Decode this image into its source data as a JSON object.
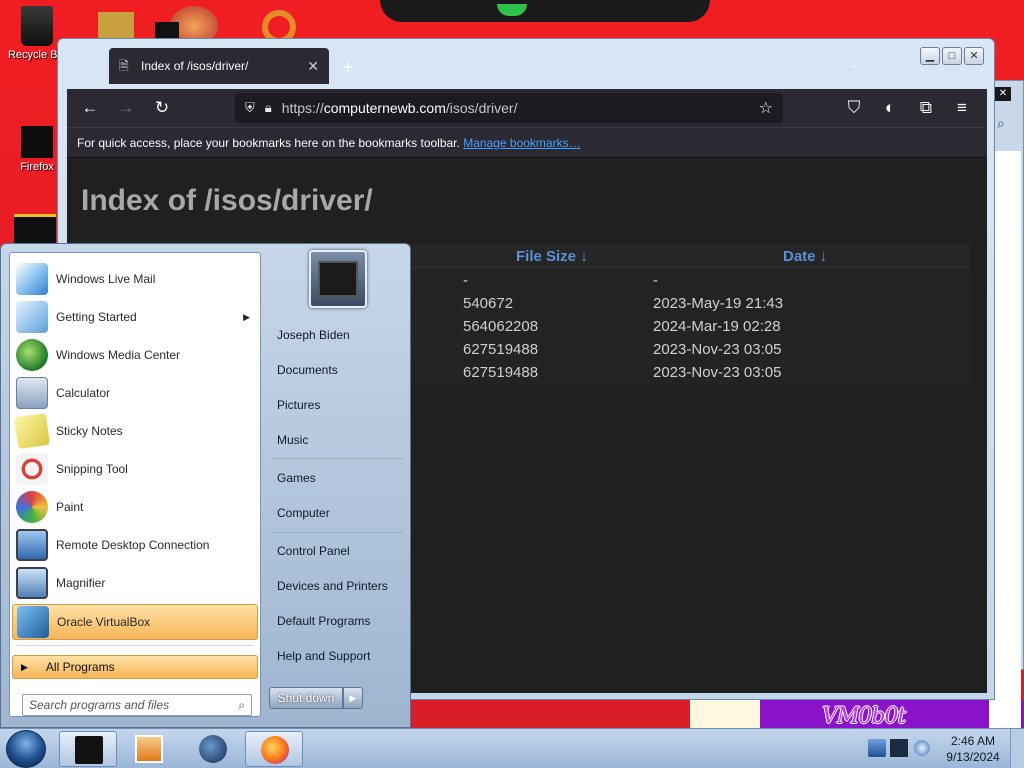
{
  "desktop": {
    "icons": [
      {
        "label": "Recycle Bin",
        "icon": "recycle-bin-icon"
      },
      {
        "label": "Firefox",
        "icon": "firefox-icon"
      }
    ],
    "wallpaper_text": "VM0b0t"
  },
  "browser": {
    "tab": {
      "title": "Index of /isos/driver/",
      "icon": "file-icon",
      "close_glyph": "✕"
    },
    "new_tab_glyph": "+",
    "tab_list_glyph": "⌄",
    "window_controls": {
      "minimize": "▁",
      "maximize": "□",
      "close": "✕"
    },
    "toolbar": {
      "back": "←",
      "forward": "→",
      "reload": "↻",
      "url_prefix": "https://",
      "url_host": "computernewb.com",
      "url_path": "/isos/driver/",
      "bookmark_star": "☆",
      "pocket": "⛉",
      "account": "◐",
      "extensions": "⧉",
      "menu": "≡"
    },
    "bookmarks_bar": {
      "message": "For quick access, place your bookmarks here on the bookmarks toolbar.",
      "link": "Manage bookmarks…"
    },
    "page": {
      "heading": "Index of /isos/driver/",
      "columns": {
        "size": "File Size  ↓",
        "date": "Date  ↓"
      },
      "rows": [
        {
          "size": "-",
          "date": "-"
        },
        {
          "size": "540672",
          "date": "2023-May-19 21:43"
        },
        {
          "size": "564062208",
          "date": "2024-Mar-19 02:28"
        },
        {
          "size": "627519488",
          "date": "2023-Nov-23 03:05"
        },
        {
          "size": "627519488",
          "date": "2023-Nov-23 03:05"
        }
      ]
    }
  },
  "start_menu": {
    "programs": [
      {
        "label": "Windows Live Mail",
        "icon": "mail-icon",
        "color": "#3a8fd8"
      },
      {
        "label": "Getting Started",
        "icon": "getting-started-icon",
        "color": "#5aa0d8",
        "submenu": true
      },
      {
        "label": "Windows Media Center",
        "icon": "media-center-icon",
        "color": "#2a9a3a"
      },
      {
        "label": "Calculator",
        "icon": "calculator-icon",
        "color": "#8aa2c0"
      },
      {
        "label": "Sticky Notes",
        "icon": "sticky-notes-icon",
        "color": "#e8df6a"
      },
      {
        "label": "Snipping Tool",
        "icon": "scissors-icon",
        "color": "#d8403a"
      },
      {
        "label": "Paint",
        "icon": "paint-icon",
        "color": "#e0b040"
      },
      {
        "label": "Remote Desktop Connection",
        "icon": "remote-desktop-icon",
        "color": "#3c78c0"
      },
      {
        "label": "Magnifier",
        "icon": "magnifier-icon",
        "color": "#5080b8"
      },
      {
        "label": "Oracle VirtualBox",
        "icon": "virtualbox-icon",
        "color": "#2f6fb0",
        "selected": true
      }
    ],
    "submenu_arrow": "▶",
    "all_programs": "All Programs",
    "all_programs_arrow": "▶",
    "search_placeholder": "Search programs and files",
    "search_icon_glyph": "⌕",
    "user_name": "Joseph Biden",
    "places": [
      "Documents",
      "Pictures",
      "Music",
      "Games",
      "Computer",
      "Control Panel",
      "Devices and Printers",
      "Default Programs",
      "Help and Support"
    ],
    "shutdown": "Shut down",
    "shutdown_arrow": "▶"
  },
  "taskbar": {
    "apps": [
      {
        "name": "start-orb"
      },
      {
        "name": "virtualbox-app",
        "active": true
      },
      {
        "name": "media-player-app"
      },
      {
        "name": "media-center-app"
      },
      {
        "name": "firefox-app",
        "active": true
      }
    ],
    "clock": {
      "time": "2:46 AM",
      "date": "9/13/2024"
    }
  }
}
